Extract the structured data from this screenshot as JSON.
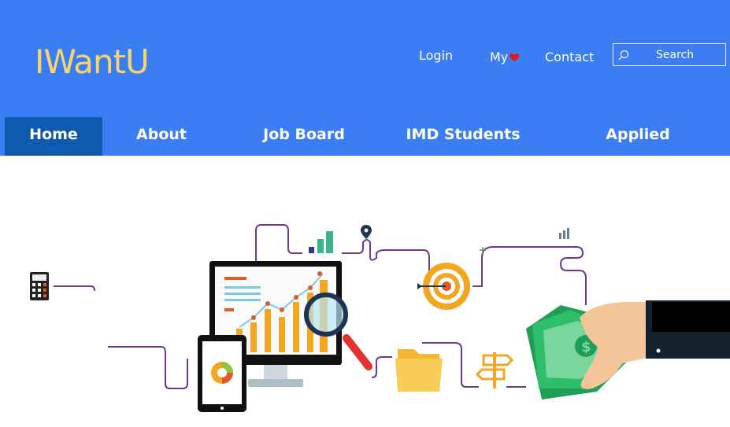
{
  "header": {
    "logo": "IWantU",
    "links": {
      "login": "Login",
      "my": "My",
      "contact": "Contact"
    },
    "search": {
      "placeholder": "Search"
    }
  },
  "nav": {
    "items": [
      {
        "label": "Home",
        "active": true
      },
      {
        "label": "About",
        "active": false
      },
      {
        "label": "Job Board",
        "active": false
      },
      {
        "label": "IMD Students",
        "active": false
      },
      {
        "label": "Applied Projects",
        "active": false
      }
    ]
  },
  "colors": {
    "header_bg": "#3b7df3",
    "nav_active_bg": "#0e5ab1",
    "logo": "#f6d56a",
    "heart": "#e4151d"
  },
  "hero": {
    "icons": [
      "calculator-icon",
      "bar-chart-icon",
      "location-pin-icon",
      "target-icon",
      "signpost-icon",
      "folder-icon",
      "tablet-pie-chart",
      "monitor-bar-chart",
      "magnifying-glass-icon",
      "hand-with-money",
      "plus-icon",
      "small-bar-chart-icon"
    ]
  }
}
